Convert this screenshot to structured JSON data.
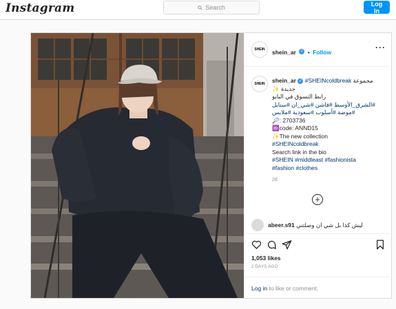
{
  "nav": {
    "logo": "Instagram",
    "search_placeholder": "Search",
    "login_label": "Log In"
  },
  "post": {
    "username": "shein_ar",
    "follow_label": "Follow",
    "avatar_text": "SHEIN",
    "caption": {
      "author": "shein_ar",
      "line1_tag": "#SHEINcoldbreak",
      "line1_text": "مجموعة",
      "line2": "جديدة",
      "line3": "رابط التسوق في البايو",
      "line4": "الشرق_الأوسط #فاشن #شي_ان #ستايل#",
      "line5": "موضة #أسلوب #سعودية #ملابس#",
      "line6": "2703736",
      "line7": "code: ANND15",
      "line8": "The new collection",
      "line9": "#SHEINcoldbreak",
      "line10": "Search link in the bio",
      "line11_tags": "#SHEIN #middleast #fashionista",
      "line12_tags": "#fashion #clothes",
      "time": "2d"
    },
    "comment": {
      "author": "abeer.s91",
      "text": "ليش كذا بل شي ان وصلتني"
    },
    "likes": "1,053 likes",
    "posted": "2 DAYS AGO",
    "login_link": "Log in",
    "login_rest": " to like or comment."
  }
}
